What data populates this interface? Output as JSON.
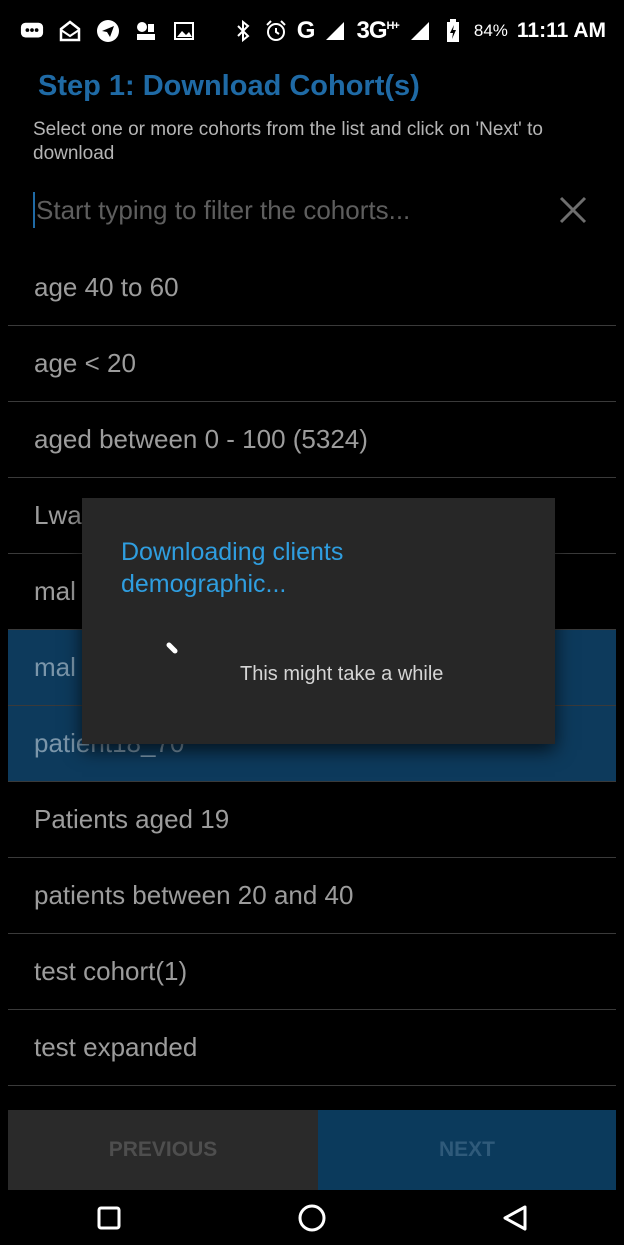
{
  "status_bar": {
    "network": "G",
    "network2": "3G",
    "network2_sup": "H+",
    "battery_percent": "84%",
    "time": "11:11 AM"
  },
  "header": {
    "title": "Step 1: Download Cohort(s)",
    "subtitle": "Select one or more cohorts from the list and click on 'Next' to download"
  },
  "filter": {
    "placeholder": "Start typing to filter the cohorts...",
    "clear_icon": "close-icon"
  },
  "cohorts": [
    {
      "label": "age 40 to 60",
      "selected": false
    },
    {
      "label": "age < 20",
      "selected": false
    },
    {
      "label": "aged between 0 - 100 (5324)",
      "selected": false
    },
    {
      "label": "Lwa",
      "selected": false
    },
    {
      "label": "mal",
      "selected": false
    },
    {
      "label": "mal",
      "selected": true
    },
    {
      "label": "patient18_70",
      "selected": true
    },
    {
      "label": "Patients aged 19",
      "selected": false
    },
    {
      "label": "patients between 20 and 40",
      "selected": false
    },
    {
      "label": "test cohort(1)",
      "selected": false
    },
    {
      "label": "test expanded",
      "selected": false
    }
  ],
  "buttons": {
    "previous": "PREVIOUS",
    "next": "NEXT"
  },
  "dialog": {
    "title": "Downloading clients demographic...",
    "message": "This might take a while"
  },
  "colors": {
    "accent": "#2f9ee0",
    "selected_row": "#0d3a5c",
    "dialog_bg": "#272727"
  }
}
